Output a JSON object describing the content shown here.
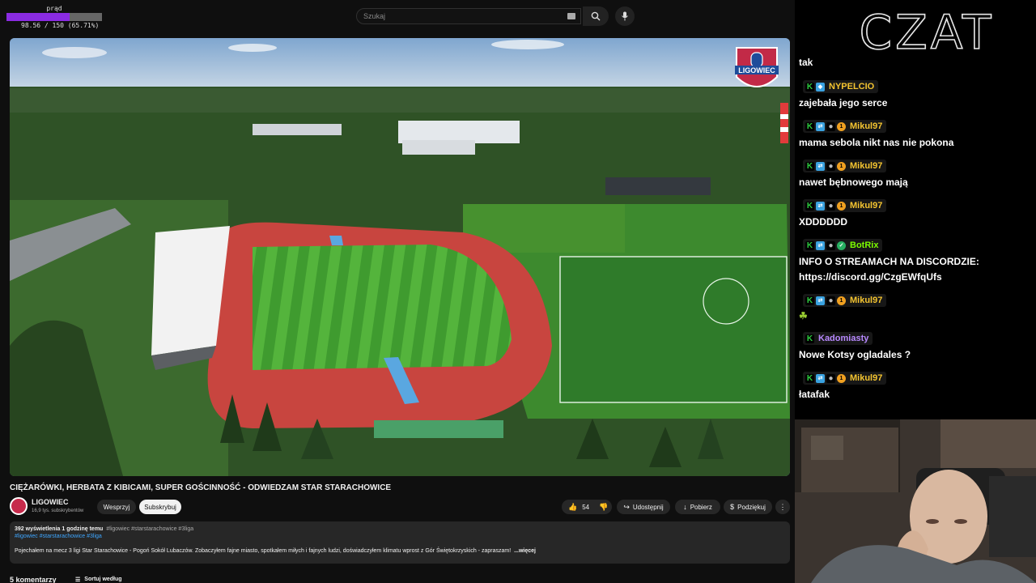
{
  "power": {
    "label": "prąd",
    "value_text": "98.56 / 150 (65.71%)",
    "fill_fraction": 0.6571,
    "color": "#8a2be2"
  },
  "search": {
    "placeholder": "Szukaj"
  },
  "video": {
    "logo_text": "LIGOWIEC"
  },
  "title": "CIĘŻARÓWKI, HERBATA Z KIBICAMI, SUPER GOŚCINNOŚĆ - ODWIEDZAM STAR STARACHOWICE",
  "channel": {
    "name": "LIGOWIEC",
    "subs": "16,9 tys. subskrybentów"
  },
  "buttons": {
    "support": "Wesprzyj",
    "subscribe": "Subskrybuj",
    "likes": "54",
    "share": "Udostępnij",
    "download": "Pobierz",
    "thanks": "Podziękuj"
  },
  "description": {
    "meta": "392 wyświetlenia  1 godzinę temu",
    "tags1": "#ligowiec #starstarachowice #3liga",
    "tags2": "#ligowiec #starstarachowice #3liga",
    "text": "Pojechałem na mecz 3 ligi Star Starachowice - Pogoń Sokół Lubaczów. Zobaczyłem fajne miasto, spotkałem miłych i fajnych ludzi, doświadczyłem klimatu wprost z Gór Świętokrzyskich - zapraszam!",
    "more": "...więcej"
  },
  "comments": {
    "count": "5 komentarzy",
    "sort": "Sortuj według"
  },
  "chat": {
    "title": "CZAT",
    "messages": [
      {
        "user": "",
        "text": "tak",
        "badges": []
      },
      {
        "user": "NYPELCIO",
        "text": "zajebała jego serce",
        "badges": [
          "k",
          "vip"
        ]
      },
      {
        "user": "Mikul97",
        "text": "mama sebola nikt nas nie pokona",
        "badges": [
          "k",
          "blue",
          "dot",
          "one"
        ]
      },
      {
        "user": "Mikul97",
        "text": "nawet bębnowego mają",
        "badges": [
          "k",
          "blue",
          "dot",
          "one"
        ]
      },
      {
        "user": "Mikul97",
        "text": "XDDDDDD",
        "badges": [
          "k",
          "blue",
          "dot",
          "one"
        ]
      },
      {
        "user": "BotRix",
        "text": "INFO O STREAMACH NA DISCORDZIE:",
        "text2": "https://discord.gg/CzgEWfqUfs",
        "badges": [
          "k",
          "blue",
          "dot",
          "check"
        ]
      },
      {
        "user": "Mikul97",
        "text": "",
        "badges": [
          "k",
          "blue",
          "dot",
          "one"
        ]
      },
      {
        "user": "Kadomiasty",
        "text": "Nowe Kotsy ogladales ?",
        "badges": [
          "k"
        ]
      },
      {
        "user": "Mikul97",
        "text": "łatafak",
        "badges": [
          "k",
          "blue",
          "dot",
          "one"
        ]
      }
    ]
  }
}
